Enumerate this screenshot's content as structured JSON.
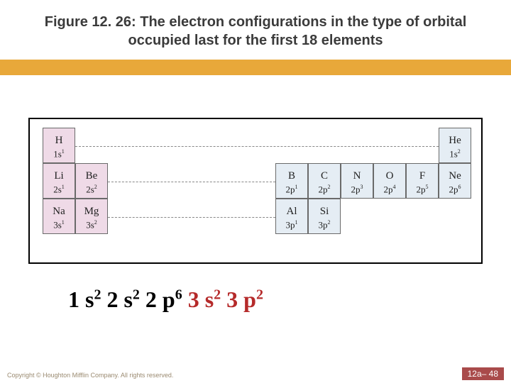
{
  "title": "Figure 12. 26:  The electron configurations in the type of orbital occupied last for the first 18 elements",
  "cells": {
    "H": {
      "sym": "H",
      "orb": "1s",
      "sup": "1"
    },
    "He": {
      "sym": "He",
      "orb": "1s",
      "sup": "2"
    },
    "Li": {
      "sym": "Li",
      "orb": "2s",
      "sup": "1"
    },
    "Be": {
      "sym": "Be",
      "orb": "2s",
      "sup": "2"
    },
    "B": {
      "sym": "B",
      "orb": "2p",
      "sup": "1"
    },
    "C": {
      "sym": "C",
      "orb": "2p",
      "sup": "2"
    },
    "N": {
      "sym": "N",
      "orb": "2p",
      "sup": "3"
    },
    "O": {
      "sym": "O",
      "orb": "2p",
      "sup": "4"
    },
    "F": {
      "sym": "F",
      "orb": "2p",
      "sup": "5"
    },
    "Ne": {
      "sym": "Ne",
      "orb": "2p",
      "sup": "6"
    },
    "Na": {
      "sym": "Na",
      "orb": "3s",
      "sup": "1"
    },
    "Mg": {
      "sym": "Mg",
      "orb": "3s",
      "sup": "2"
    },
    "Al": {
      "sym": "Al",
      "orb": "3p",
      "sup": "1"
    },
    "Si": {
      "sym": "Si",
      "orb": "3p",
      "sup": "2"
    }
  },
  "config": {
    "p1b": "1 s",
    "p1s": "2",
    "p2b": "2 s",
    "p2s": "2",
    "p3b": "2 p",
    "p3s": "6",
    "p4b": "3 s",
    "p4s": "2",
    "p5b": "3 p",
    "p5s": "2"
  },
  "copyright": "Copyright © Houghton Mifflin Company. All rights reserved.",
  "pageno": "12a– 48"
}
